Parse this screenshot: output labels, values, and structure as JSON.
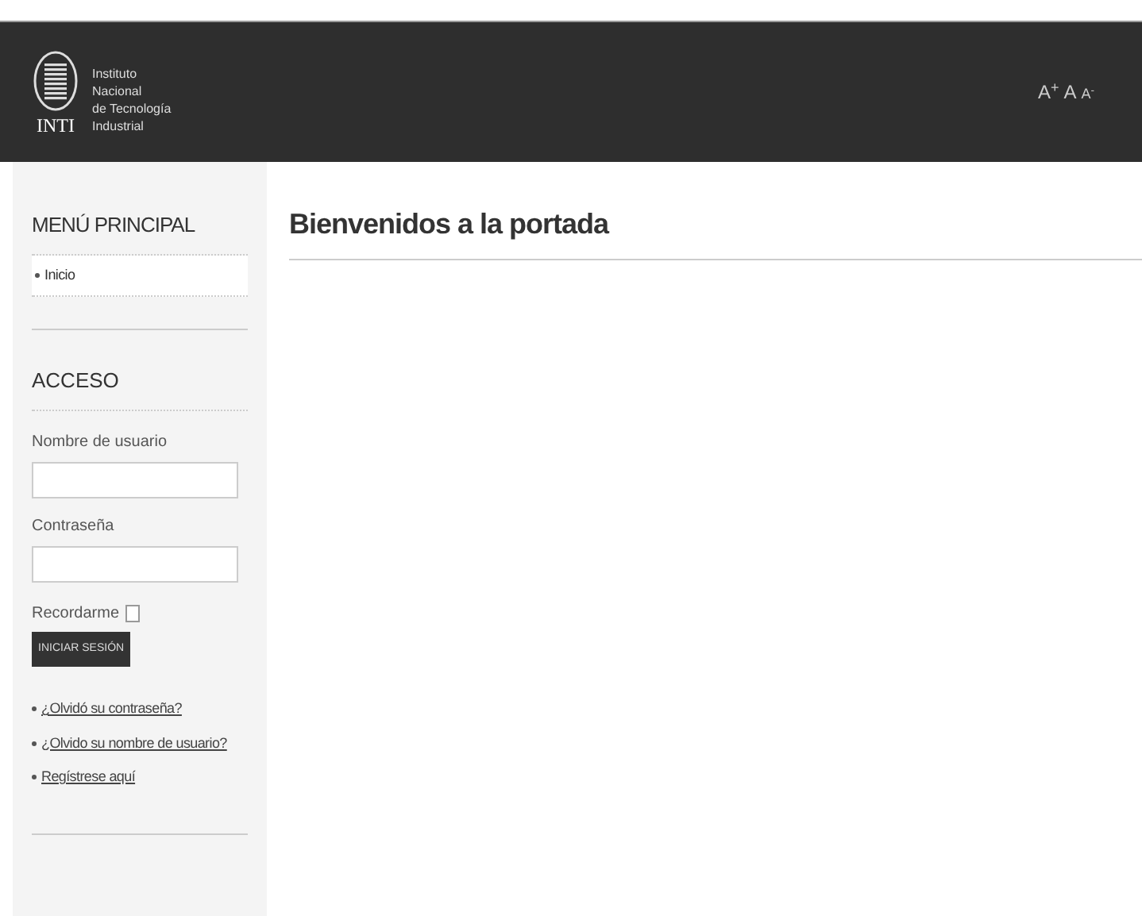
{
  "header": {
    "logo_text": "INTI",
    "logo_lines": [
      "Instituto",
      "Nacional",
      "de Tecnología",
      "Industrial"
    ],
    "font_size_buttons": [
      "A$^{+}$",
      "A",
      "A$^{-}$"
    ]
  },
  "sidebar": {
    "menu": {
      "title": "MENÚ PRINCIPAL",
      "items": [
        {
          "label": "Inicio",
          "selected": true
        }
      ]
    },
    "login": {
      "title": "ACCESO",
      "username_label": "Nombre de usuario",
      "password_label": "Contraseña",
      "remember_label": "Recordarme",
      "remember_checked": false,
      "submit": "INICIAR SESIÓN",
      "links": [
        "¿Olvidó su contraseña?",
        "¿Olvido su nombre de usuario?",
        "Regístrese aquí"
      ]
    }
  },
  "main": {
    "title": "Bienvenidos a la portada"
  }
}
